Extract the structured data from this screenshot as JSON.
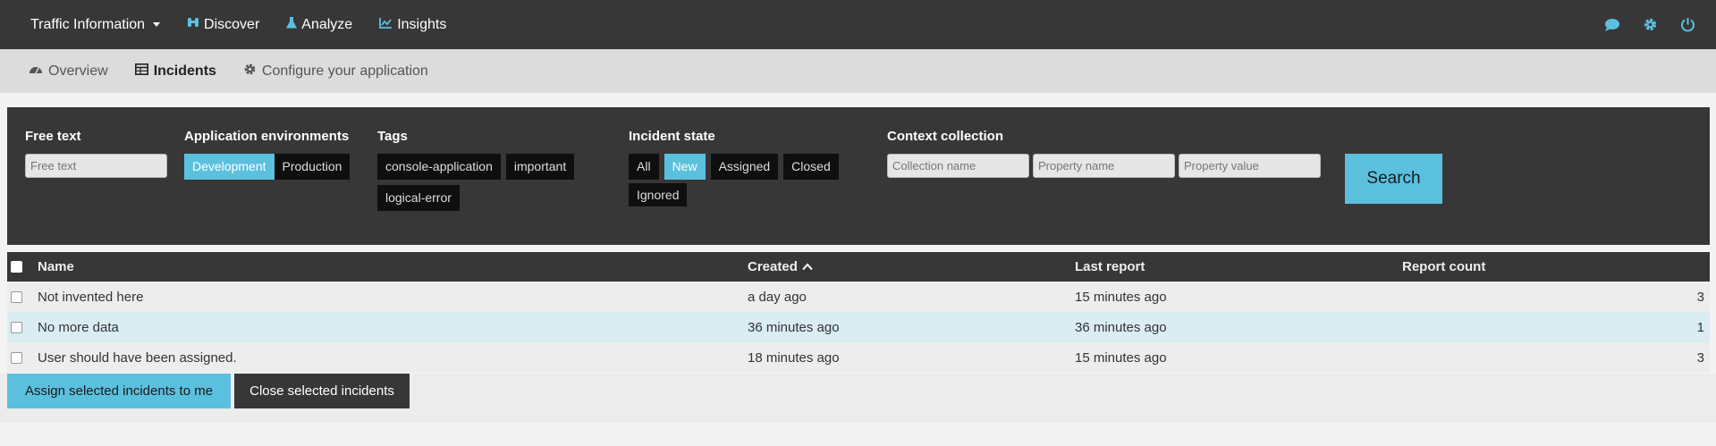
{
  "topbar": {
    "app_title": "Traffic Information",
    "discover": "Discover",
    "analyze": "Analyze",
    "insights": "Insights",
    "icons": [
      "chat-icon",
      "gear-icon",
      "power-icon"
    ]
  },
  "subnav": {
    "overview": "Overview",
    "incidents": "Incidents",
    "configure": "Configure your application"
  },
  "filters": {
    "free_text_label": "Free text",
    "free_text_placeholder": "Free text",
    "env_label": "Application environments",
    "envs": [
      "Development",
      "Production"
    ],
    "tags_label": "Tags",
    "tags": [
      "console-application",
      "important",
      "logical-error"
    ],
    "state_label": "Incident state",
    "states": [
      "All",
      "New",
      "Assigned",
      "Closed",
      "Ignored"
    ],
    "selected_state": "New",
    "selected_env": "Development",
    "context_label": "Context collection",
    "collection_placeholder": "Collection name",
    "property_placeholder": "Property name",
    "value_placeholder": "Property value",
    "search_button": "Search"
  },
  "table": {
    "headers": {
      "name": "Name",
      "created": "Created",
      "last_report": "Last report",
      "report_count": "Report count"
    },
    "rows": [
      {
        "name": "Not invented here",
        "created": "a day ago",
        "last_report": "15 minutes ago",
        "count": "3"
      },
      {
        "name": "No more data",
        "created": "36 minutes ago",
        "last_report": "36 minutes ago",
        "count": "1"
      },
      {
        "name": "User should have been assigned.",
        "created": "18 minutes ago",
        "last_report": "15 minutes ago",
        "count": "3"
      }
    ]
  },
  "actions": {
    "assign": "Assign selected incidents to me",
    "close": "Close selected incidents"
  },
  "colors": {
    "accent": "#5bc0de",
    "dark": "#373737"
  }
}
